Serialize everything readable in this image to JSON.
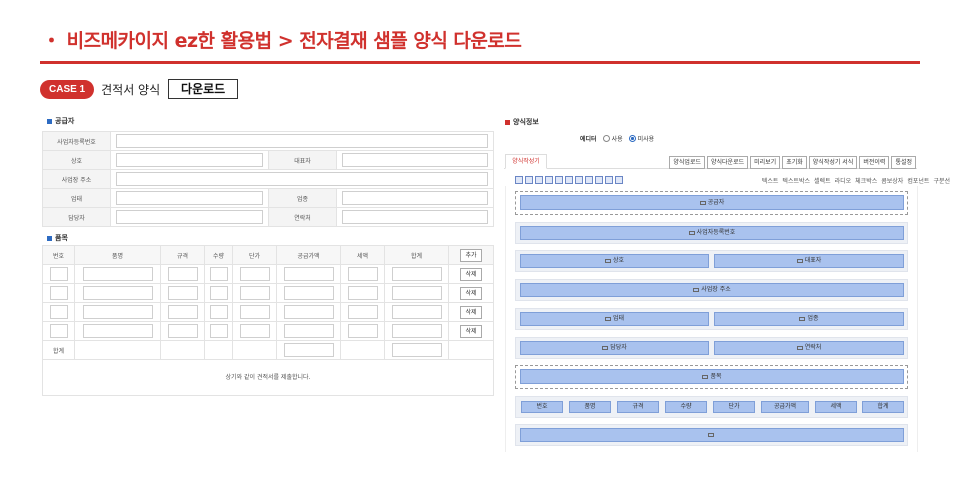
{
  "header": {
    "title": "・ 비즈메카이지 ez한 활용법 > 전자결재 샘플 양식 다운로드",
    "case_badge": "CASE 1",
    "case_text": "견적서 양식",
    "download_label": "다운로드"
  },
  "supplier": {
    "section_title": "공급자",
    "fields": {
      "bizno": "사업자등록번호",
      "name": "상호",
      "ceo": "대표자",
      "address": "사업장 주소",
      "biztype": "업태",
      "item": "업종",
      "manager": "담당자",
      "contact": "연락처"
    }
  },
  "items": {
    "section_title": "품목",
    "columns": [
      "번호",
      "품명",
      "규격",
      "수량",
      "단가",
      "공급가액",
      "세액",
      "합계"
    ],
    "add_label": "추가",
    "delete_label": "삭제",
    "total_label": "합계",
    "footer_text": "상기와 같이 견적서를 제출합니다."
  },
  "form_info": {
    "section_title": "양식정보",
    "editor_label": "에디터",
    "radio_use": "사용",
    "radio_nouse": "미사용",
    "active_tab": "양식작성기",
    "toolbar": [
      "양식업로드",
      "양식다운로드",
      "미리보기",
      "초기화",
      "양식작성기 서식",
      "버전이력",
      "통설정"
    ],
    "palette_labels": [
      "텍스트",
      "텍스트박스",
      "셀렉트",
      "라디오",
      "체크박스",
      "콤보상자",
      "컴포넌트",
      "구분선"
    ]
  },
  "designer": {
    "supplier": "공급자",
    "bizno": "사업자등록번호",
    "name": "상호",
    "ceo": "대표자",
    "address": "사업장 주소",
    "biztype": "업태",
    "item": "업종",
    "manager": "담당자",
    "contact": "연락처",
    "items": "품목",
    "cols": [
      "번호",
      "품명",
      "규격",
      "수량",
      "단가",
      "공급가액",
      "세액",
      "합계"
    ]
  }
}
